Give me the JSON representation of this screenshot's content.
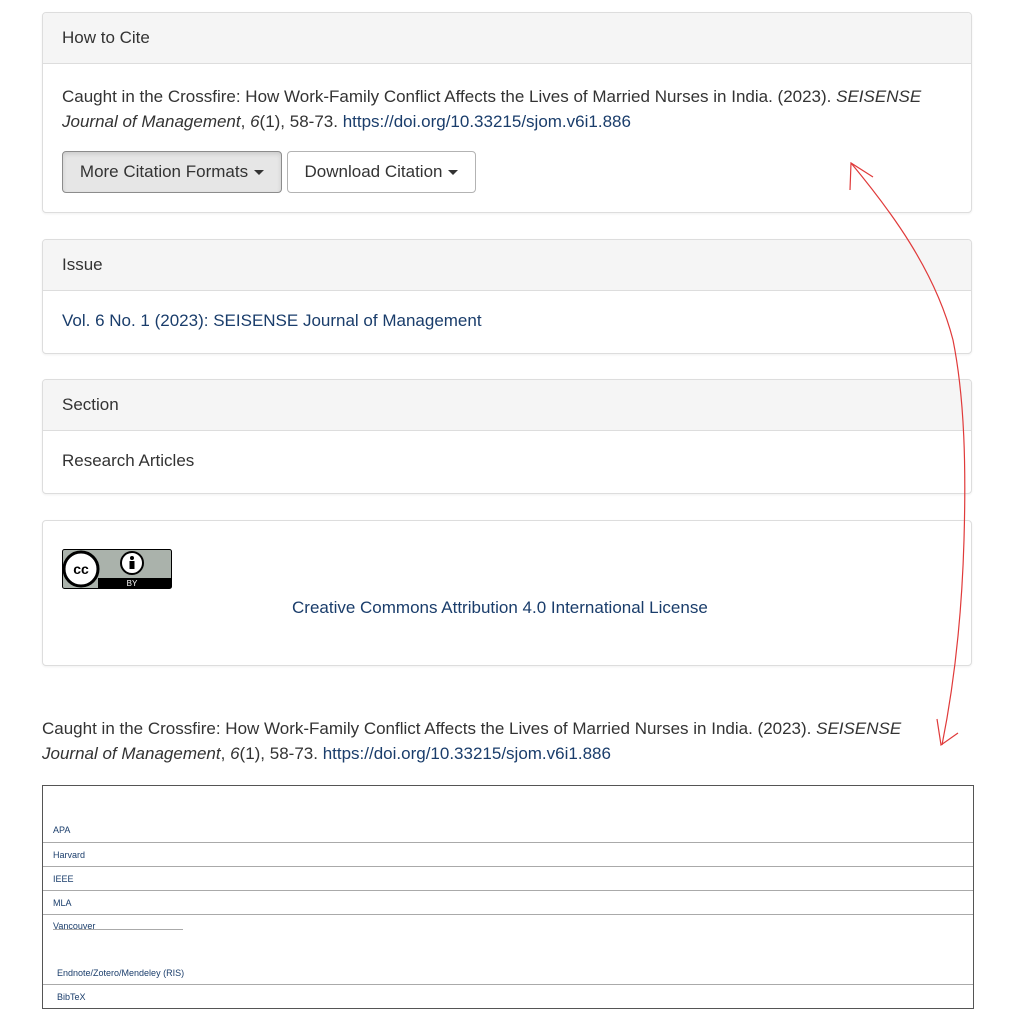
{
  "cite": {
    "heading": "How to Cite",
    "text": "Caught in the Crossfire: How Work-Family Conflict Affects the Lives of Married Nurses in India. (2023). ",
    "journal": "SEISENSE Journal of Management",
    "sep1": ", ",
    "volume": "6",
    "issue_pages": "(1), 58-73. ",
    "doi": "https://doi.org/10.33215/sjom.v6i1.886",
    "more_formats_label": "More Citation Formats",
    "download_label": "Download Citation"
  },
  "issue": {
    "heading": "Issue",
    "link": "Vol. 6 No. 1 (2023): SEISENSE Journal of Management"
  },
  "section": {
    "heading": "Section",
    "value": "Research Articles"
  },
  "license": {
    "badge_cc": "cc",
    "badge_by": "BY",
    "link": "Creative Commons Attribution 4.0 International License"
  },
  "expanded_citation": {
    "text": "Caught in the Crossfire: How Work-Family Conflict Affects the Lives of Married Nurses in India. (2023). ",
    "journal": "SEISENSE Journal of Management",
    "sep1": ", ",
    "volume": "6",
    "issue_pages": "(1), 58-73. ",
    "doi": "https://doi.org/10.33215/sjom.v6i1.886"
  },
  "formats": [
    "APA",
    "Harvard",
    "IEEE",
    "MLA",
    "Vancouver"
  ],
  "downloads": [
    "Endnote/Zotero/Mendeley (RIS)",
    "BibTeX"
  ],
  "colors": {
    "link": "#1a3d6b",
    "annotation_arrow": "#e03a3a"
  }
}
